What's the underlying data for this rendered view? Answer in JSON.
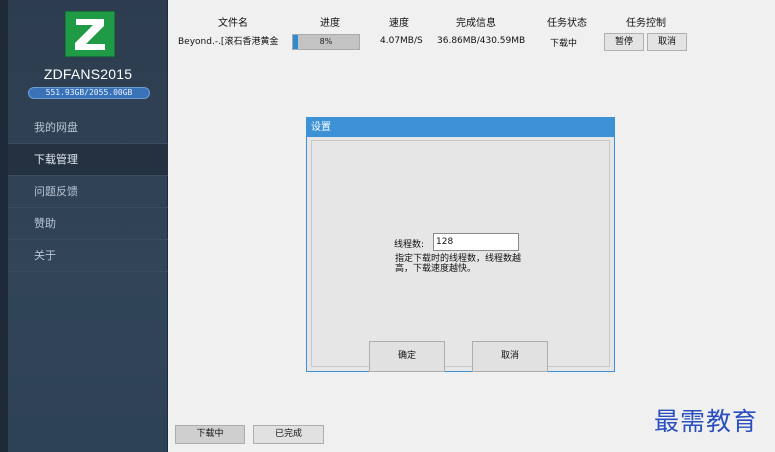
{
  "sidebar": {
    "app_name": "ZDFANS2015",
    "quota": "551.93GB/2055.00GB",
    "logo_letter": "Z",
    "items": [
      {
        "label": "我的网盘"
      },
      {
        "label": "下载管理",
        "active": true
      },
      {
        "label": "问题反馈"
      },
      {
        "label": "赞助"
      },
      {
        "label": "关于"
      }
    ]
  },
  "downloads": {
    "headers": {
      "filename": "文件名",
      "progress": "进度",
      "speed": "速度",
      "done_info": "完成信息",
      "status": "任务状态",
      "control": "任务控制"
    },
    "rows": [
      {
        "filename": "Beyond.-.[滚石香港黄金",
        "progress": 8,
        "progress_text": "8%",
        "speed": "4.07MB/S",
        "done_info": "36.86MB/430.59MB",
        "status": "下载中",
        "pause_label": "暂停",
        "cancel_label": "取消"
      }
    ]
  },
  "dialog": {
    "title": "设置",
    "field_label": "线程数:",
    "field_value": "128",
    "hint": "指定下载时的线程数，线程数越高，下载速度越快。",
    "ok_label": "确定",
    "cancel_label": "取消"
  },
  "tabs": {
    "downloading": "下载中",
    "completed": "已完成"
  },
  "watermark": "最需教育",
  "colors": {
    "sidebar_bg": "#2e4257",
    "accent": "#3d91d6",
    "logo_green": "#1f9a45",
    "progress_fill": "#2f8ccf",
    "watermark": "#2a4fbf"
  }
}
